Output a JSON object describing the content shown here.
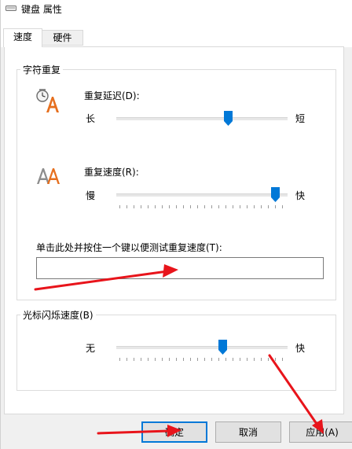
{
  "window": {
    "title": "键盘 属性",
    "title_icon": "keyboard-icon"
  },
  "tabs": [
    {
      "label": "速度",
      "active": true
    },
    {
      "label": "硬件",
      "active": false
    }
  ],
  "repeat_group": {
    "title": "字符重复",
    "delay": {
      "label": "重复延迟(D):",
      "min_label": "长",
      "max_label": "短",
      "value_fraction": 0.66,
      "icon": "clock-letter-a-icon"
    },
    "rate": {
      "label": "重复速度(R):",
      "min_label": "慢",
      "max_label": "快",
      "value_fraction": 0.95,
      "icon": "double-letter-a-icon"
    },
    "test": {
      "label": "单击此处并按住一个键以便测试重复速度(T):",
      "value": ""
    }
  },
  "cursor_group": {
    "title": "光标闪烁速度(B)",
    "min_label": "无",
    "max_label": "快",
    "value_fraction": 0.63
  },
  "buttons": {
    "ok": "确定",
    "cancel": "取消",
    "apply": "应用(A)"
  },
  "colors": {
    "accent": "#0078d7",
    "annotation_arrow": "#e8141b"
  }
}
